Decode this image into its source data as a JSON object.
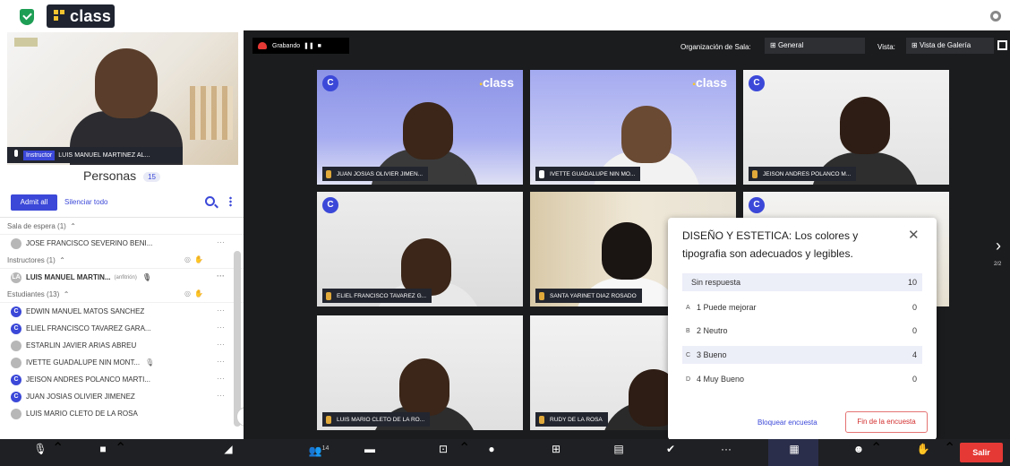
{
  "app": {
    "brand": "class"
  },
  "sidebar": {
    "instructor_badge": "Instructor",
    "instructor_name": "LUIS MANUEL MARTINEZ AL...",
    "people_title": "Personas",
    "people_count": "15",
    "admit_all": "Admit all",
    "silence_all": "Silenciar todo",
    "sections": {
      "waiting": "Sala de espera (1)",
      "instructors": "Instructores (1)",
      "students": "Estudiantes (13)"
    },
    "waiting_list": [
      "JOSE FRANCISCO SEVERINO BENI..."
    ],
    "instructor_list": [
      {
        "name": "LUIS MANUEL MARTIN...",
        "tag": "(anfitrión)"
      }
    ],
    "students": [
      {
        "name": "EDWIN MANUEL MATOS SANCHEZ",
        "avatar": "C"
      },
      {
        "name": "ELIEL FRANCISCO TAVAREZ GARA...",
        "avatar": "C"
      },
      {
        "name": "ESTARLIN JAVIER ARIAS ABREU",
        "avatar": ""
      },
      {
        "name": "IVETTE GUADALUPE NIN MONT...",
        "avatar": ""
      },
      {
        "name": "JEISON ANDRES POLANCO MARTI...",
        "avatar": "C"
      },
      {
        "name": "JUAN JOSIAS OLIVIER JIMENEZ",
        "avatar": "C"
      },
      {
        "name": "LUIS MARIO CLETO DE LA ROSA",
        "avatar": ""
      }
    ],
    "more": "···",
    "collapse": "‹I"
  },
  "stage": {
    "recording": "Grabando",
    "org_label": "Organización de Sala:",
    "org_value": "General",
    "view_label": "Vista:",
    "view_value": "Vista de Galería",
    "page": "2/2",
    "tiles": [
      {
        "name": "JUAN JOSIAS OLIVIER JIMEN..."
      },
      {
        "name": "IVETTE GUADALUPE NIN MO..."
      },
      {
        "name": "JEISON ANDRES POLANCO M..."
      },
      {
        "name": "ELIEL FRANCISCO TAVAREZ G..."
      },
      {
        "name": "SANTA YARINET DIAZ ROSADO"
      },
      {
        "name": ""
      },
      {
        "name": "LUIS MARIO CLETO DE LA RO..."
      },
      {
        "name": "RUDY DE LA ROSA"
      }
    ]
  },
  "poll": {
    "title": "DISEÑO Y ESTETICA: Los colores y tipografia son adecuados y legibles.",
    "options": [
      {
        "key": "",
        "label": "Sin respuesta",
        "count": "10"
      },
      {
        "key": "A",
        "label": "1 Puede mejorar",
        "count": "0"
      },
      {
        "key": "B",
        "label": "2 Neutro",
        "count": "0"
      },
      {
        "key": "C",
        "label": "3 Bueno",
        "count": "4"
      },
      {
        "key": "D",
        "label": "4 Muy Bueno",
        "count": "0"
      }
    ],
    "block": "Bloquear encuesta",
    "end": "Fin de la encuesta"
  },
  "toolbar": {
    "participants_count": "14",
    "exit": "Salir"
  }
}
